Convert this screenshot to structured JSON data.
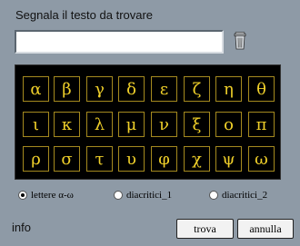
{
  "prompt_label": "Segnala il testo da trovare",
  "search": {
    "value": "",
    "placeholder": ""
  },
  "keys": [
    [
      "α",
      "β",
      "γ",
      "δ",
      "ε",
      "ζ",
      "η",
      "θ"
    ],
    [
      "ι",
      "κ",
      "λ",
      "μ",
      "ν",
      "ξ",
      "ο",
      "π"
    ],
    [
      "ρ",
      "σ",
      "τ",
      "υ",
      "φ",
      "χ",
      "ψ",
      "ω"
    ]
  ],
  "radios": [
    {
      "label": "lettere α-ω",
      "selected": true
    },
    {
      "label": "diacritici_1",
      "selected": false
    },
    {
      "label": "diacritici_2",
      "selected": false
    }
  ],
  "info_label": "info",
  "buttons": {
    "find": "trova",
    "cancel": "annulla"
  },
  "icons": {
    "trash": "trash-icon"
  },
  "colors": {
    "background": "#8e9aa6",
    "key_text": "#f0d02a",
    "key_border": "#a58a1f"
  }
}
